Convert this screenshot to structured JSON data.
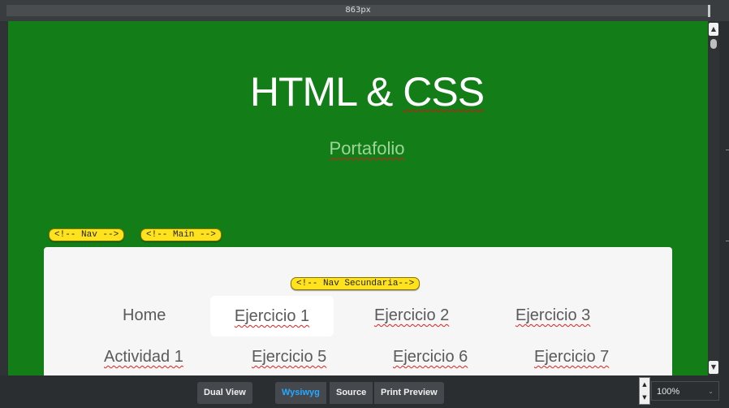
{
  "ruler": {
    "width_label": "863px"
  },
  "page": {
    "title_part1": "HTML & ",
    "title_part2": "CSS",
    "subtitle": "Portafolio"
  },
  "comment_tags": {
    "nav": "<!-- Nav -->",
    "main": "<!-- Main -->",
    "nav_secundaria": "<!-- Nav Secundaria-->"
  },
  "secondary_nav": {
    "row1": [
      "Home",
      "Ejercicio 1",
      "Ejercicio 2",
      "Ejercicio 3"
    ],
    "row2": [
      "Actividad 1",
      "Ejercicio 5",
      "Ejercicio 6",
      "Ejercicio 7"
    ],
    "active": "Ejercicio 1"
  },
  "toolbar": {
    "dual_view": "Dual View",
    "wysiwyg": "Wysiwyg",
    "source": "Source",
    "print_preview": "Print Preview",
    "zoom": "100%"
  },
  "colors": {
    "canvas_bg": "#137d17",
    "tag_bg": "#ffe21e",
    "active_view": "#28a8ff"
  },
  "icons": {
    "scroll_up": "up-arrow-icon",
    "scroll_down": "down-arrow-icon",
    "zoom_dropdown": "chevron-down-icon"
  }
}
